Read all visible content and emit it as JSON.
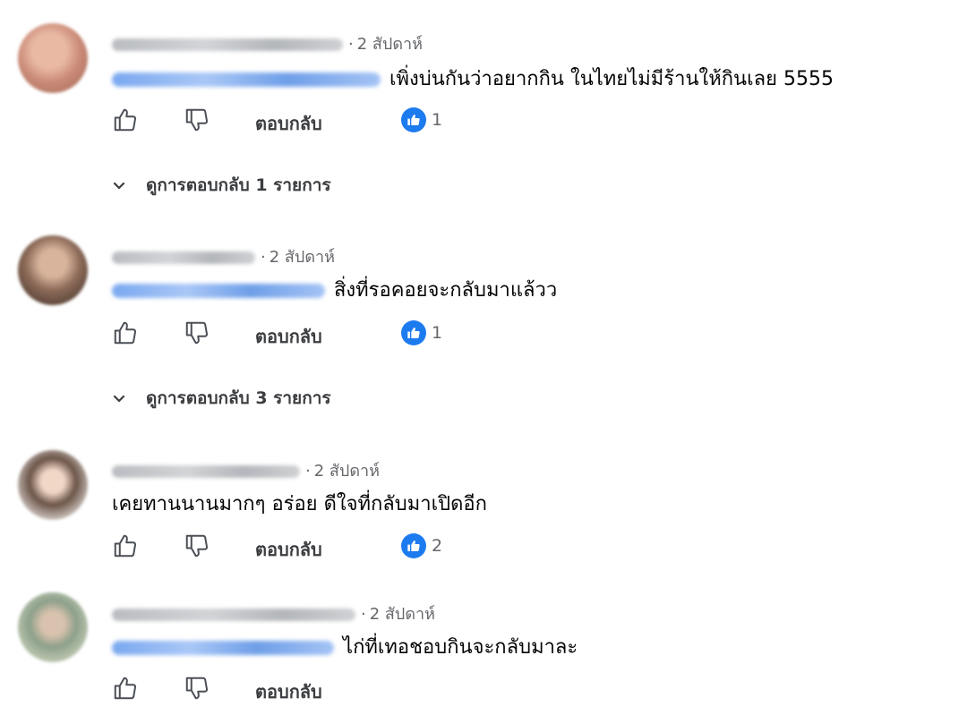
{
  "comments": [
    {
      "time": "2 สัปดาห์",
      "text": "เพิ่งบ่นกันว่าอยากกิน ในไทยไม่มีร้านให้กินเลย 5555",
      "has_mention": true,
      "reply_label": "ตอบกลับ",
      "likes": "1",
      "view_replies": "ดูการตอบกลับ 1 รายการ"
    },
    {
      "time": "2 สัปดาห์",
      "text": "สิ่งที่รอคอยจะกลับมาแล้วว",
      "has_mention": true,
      "reply_label": "ตอบกลับ",
      "likes": "1",
      "view_replies": "ดูการตอบกลับ 3 รายการ"
    },
    {
      "time": "2 สัปดาห์",
      "text": "เคยทานนานมากๆ อร่อย ดีใจที่กลับมาเปิดอีก",
      "has_mention": false,
      "reply_label": "ตอบกลับ",
      "likes": "2"
    },
    {
      "time": "2 สัปดาห์",
      "text": "ไก่ที่เทอชอบกินจะกลับมาละ",
      "has_mention": true,
      "reply_label": "ตอบกลับ"
    }
  ],
  "icons": {
    "like": "thumbs-up-outline-icon",
    "dislike": "thumbs-down-outline-icon",
    "like_badge": "like-reaction-icon",
    "expand": "chevron-down-icon"
  },
  "colors": {
    "like_blue": "#1d7bf0",
    "meta_gray": "#65676b",
    "text": "#050505"
  }
}
